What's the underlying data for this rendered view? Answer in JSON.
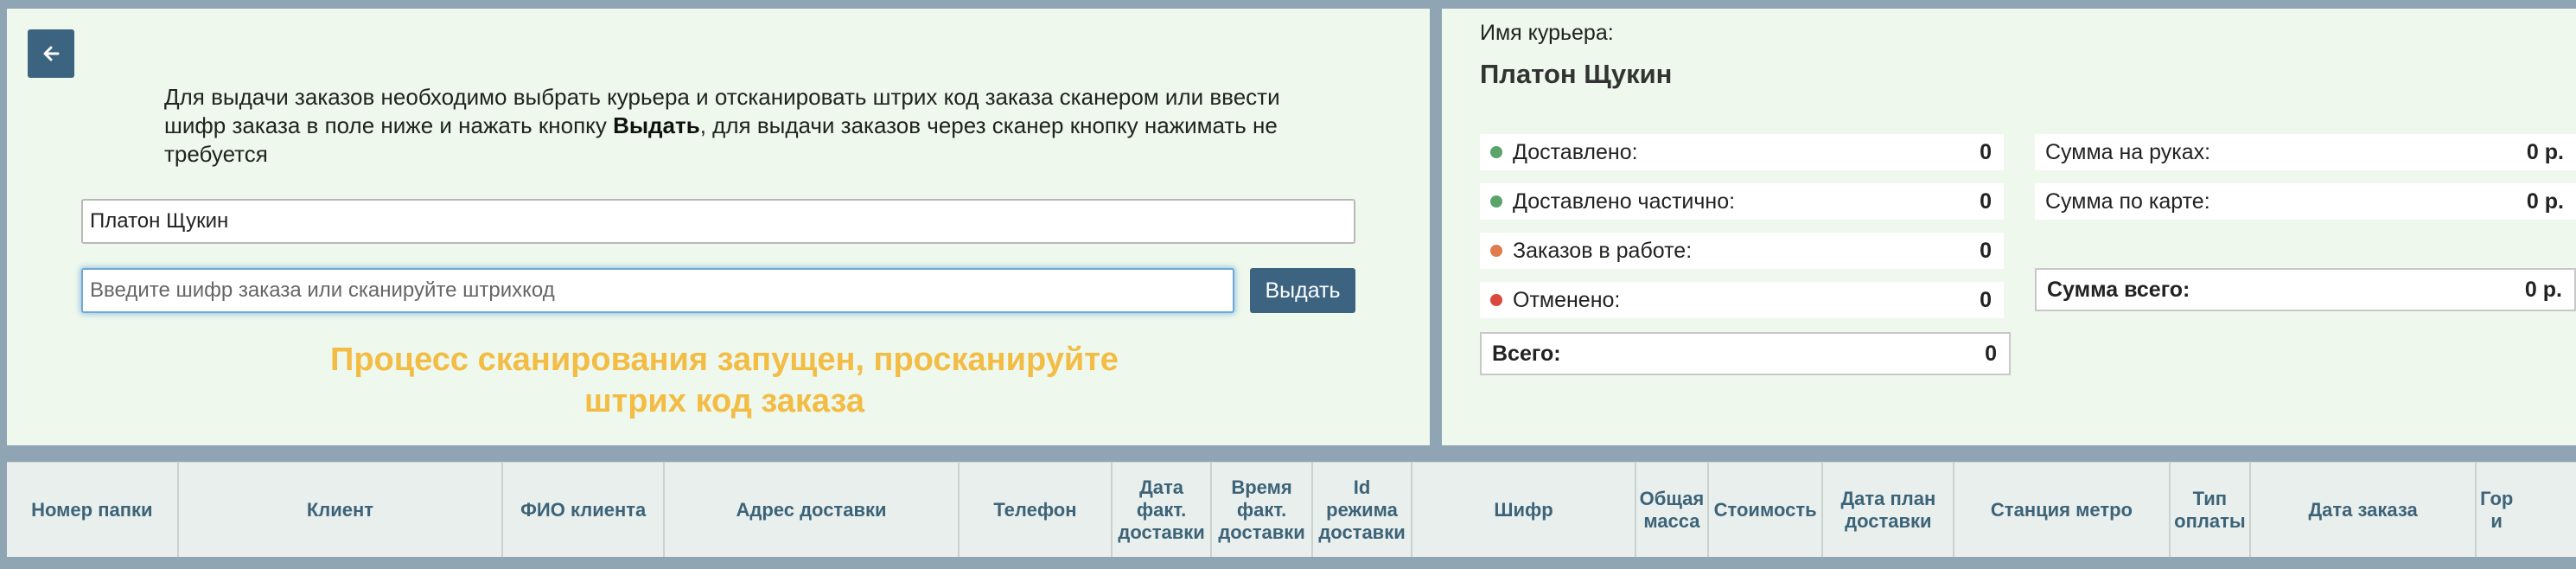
{
  "left": {
    "instructions_part1": "Для выдачи заказов необходимо выбрать курьера и отсканировать штрих код заказа сканером или ввести шифр заказа в поле ниже и нажать кнопку ",
    "instructions_bold": "Выдать",
    "instructions_part2": ", для выдачи заказов через сканер кнопку нажимать не требуется",
    "courier_value": "Платон Щукин",
    "order_placeholder": "Введите шифр заказа или сканируйте штрихкод",
    "issue_button": "Выдать",
    "scan_status": "Процесс сканирования запущен, просканируйте штрих код заказа"
  },
  "right": {
    "courier_label": "Имя курьера:",
    "courier_name": "Платон Щукин",
    "stats": [
      {
        "label": "Доставлено:",
        "value": "0",
        "color": "#5aa469"
      },
      {
        "label": "Доставлено частично:",
        "value": "0",
        "color": "#5aa469"
      },
      {
        "label": "Заказов в работе:",
        "value": "0",
        "color": "#e07b4a"
      },
      {
        "label": "Отменено:",
        "value": "0",
        "color": "#d9493e"
      }
    ],
    "total_label": "Всего:",
    "total_value": "0",
    "sums": [
      {
        "label": "Сумма на руках:",
        "value": "0 р."
      },
      {
        "label": "Сумма по карте:",
        "value": "0 р."
      }
    ],
    "sum_total_label": "Сумма всего:",
    "sum_total_value": "0 р."
  },
  "table": {
    "columns": [
      "Номер папки",
      "Клиент",
      "ФИО клиента",
      "Адрес доставки",
      "Телефон",
      "Дата\nфакт.\nдоставки",
      "Время\nфакт.\nдоставки",
      "Id\nрежима\nдоставки",
      "Шифр",
      "Общая\nмасса",
      "Стоимость",
      "Дата план\nдоставки",
      "Станция метро",
      "Тип\nоплаты",
      "Дата заказа",
      "Гор\nи"
    ]
  },
  "colors": {
    "accent": "#3c6380",
    "panel_bg": "#eef8ec",
    "scan_status": "#f2bc45"
  }
}
